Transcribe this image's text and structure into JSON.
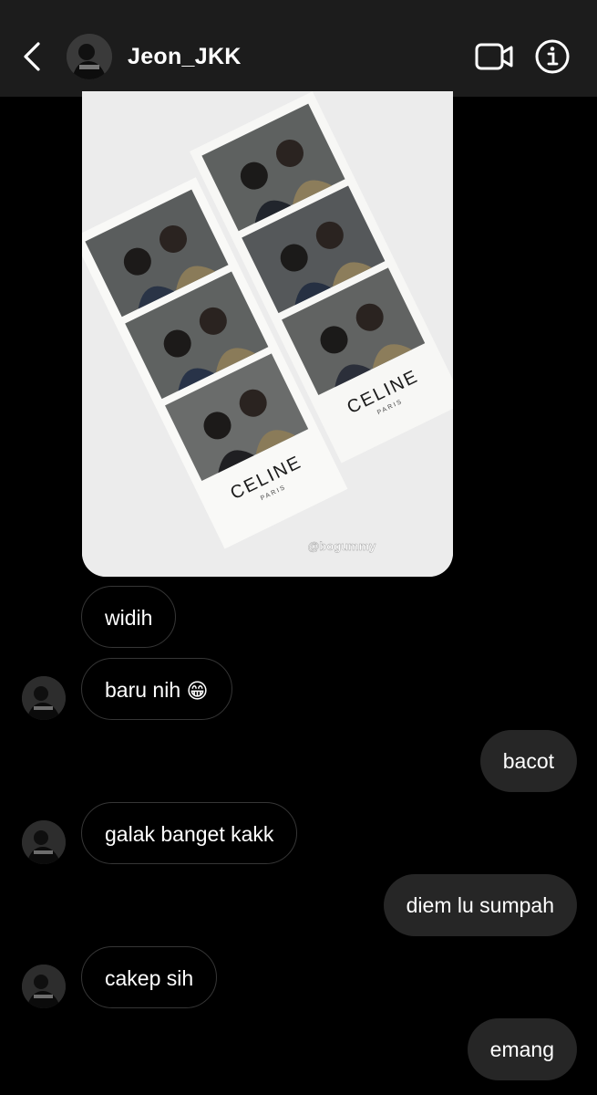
{
  "header": {
    "username": "Jeon_JKK",
    "back_icon": "chevron-left-icon",
    "video_icon": "video-camera-icon",
    "info_icon": "info-icon"
  },
  "photo": {
    "watermark": "@bogummy",
    "strips": [
      {
        "brand": "CELINE",
        "sub": "PARIS"
      },
      {
        "brand": "CELINE",
        "sub": "PARIS"
      }
    ]
  },
  "messages": [
    {
      "sender": "them",
      "text": "widih"
    },
    {
      "sender": "them",
      "text": "baru nih",
      "emoji": "😁"
    },
    {
      "sender": "me",
      "text": "bacot"
    },
    {
      "sender": "them",
      "text": "galak banget kakk"
    },
    {
      "sender": "me",
      "text": "diem lu sumpah"
    },
    {
      "sender": "them",
      "text": "cakep sih"
    },
    {
      "sender": "me",
      "text": "emang"
    }
  ],
  "colors": {
    "background": "#000000",
    "header": "#1c1c1c",
    "incoming_border": "#363636",
    "outgoing_bubble": "#262626"
  }
}
